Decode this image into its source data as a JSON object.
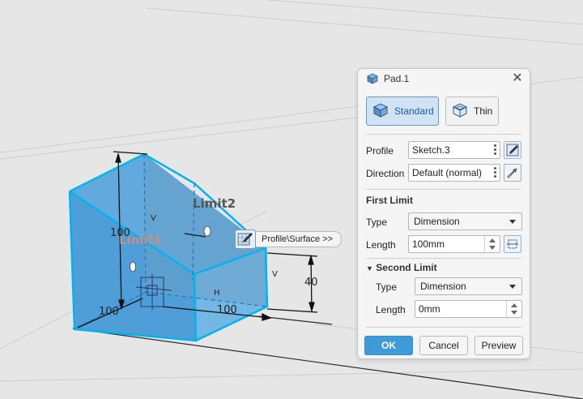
{
  "viewport": {
    "labels": {
      "limit1": "Limit1",
      "limit2": "Limit2",
      "dim_height": "100",
      "dim_left_width": "100",
      "dim_right_width": "100",
      "dim_40": "40",
      "v_mark_1": "V",
      "v_mark_2": "V",
      "h_mark": "H"
    },
    "hint_button": {
      "label": "Profile\\Surface >>",
      "icon": "sketch-pencil-icon"
    },
    "colors": {
      "solid_fill": "#3b97d9",
      "solid_edge": "#00a9e8",
      "background": "#e6e6e6"
    }
  },
  "dialog": {
    "title": "Pad.1",
    "title_icon": "pad-icon",
    "close_label": "✕",
    "modes": [
      {
        "label": "Standard",
        "icon": "solid-pad-icon",
        "active": true
      },
      {
        "label": "Thin",
        "icon": "thin-pad-icon",
        "active": false
      }
    ],
    "profile": {
      "label": "Profile",
      "value": "Sketch.3",
      "side_icon": "edit-sketch-icon"
    },
    "direction": {
      "label": "Direction",
      "value": "Default (normal)",
      "side_icon": "direction-arrow-icon"
    },
    "first_limit": {
      "title": "First Limit",
      "type_label": "Type",
      "type_value": "Dimension",
      "length_label": "Length",
      "length_value": "100mm",
      "side_icon": "measure-icon"
    },
    "second_limit": {
      "title": "Second Limit",
      "type_label": "Type",
      "type_value": "Dimension",
      "length_label": "Length",
      "length_value": "0mm"
    },
    "buttons": {
      "ok": "OK",
      "cancel": "Cancel",
      "preview": "Preview"
    },
    "colors": {
      "primary": "#3e9ad8",
      "active_mode": "#cfe3f5"
    }
  }
}
